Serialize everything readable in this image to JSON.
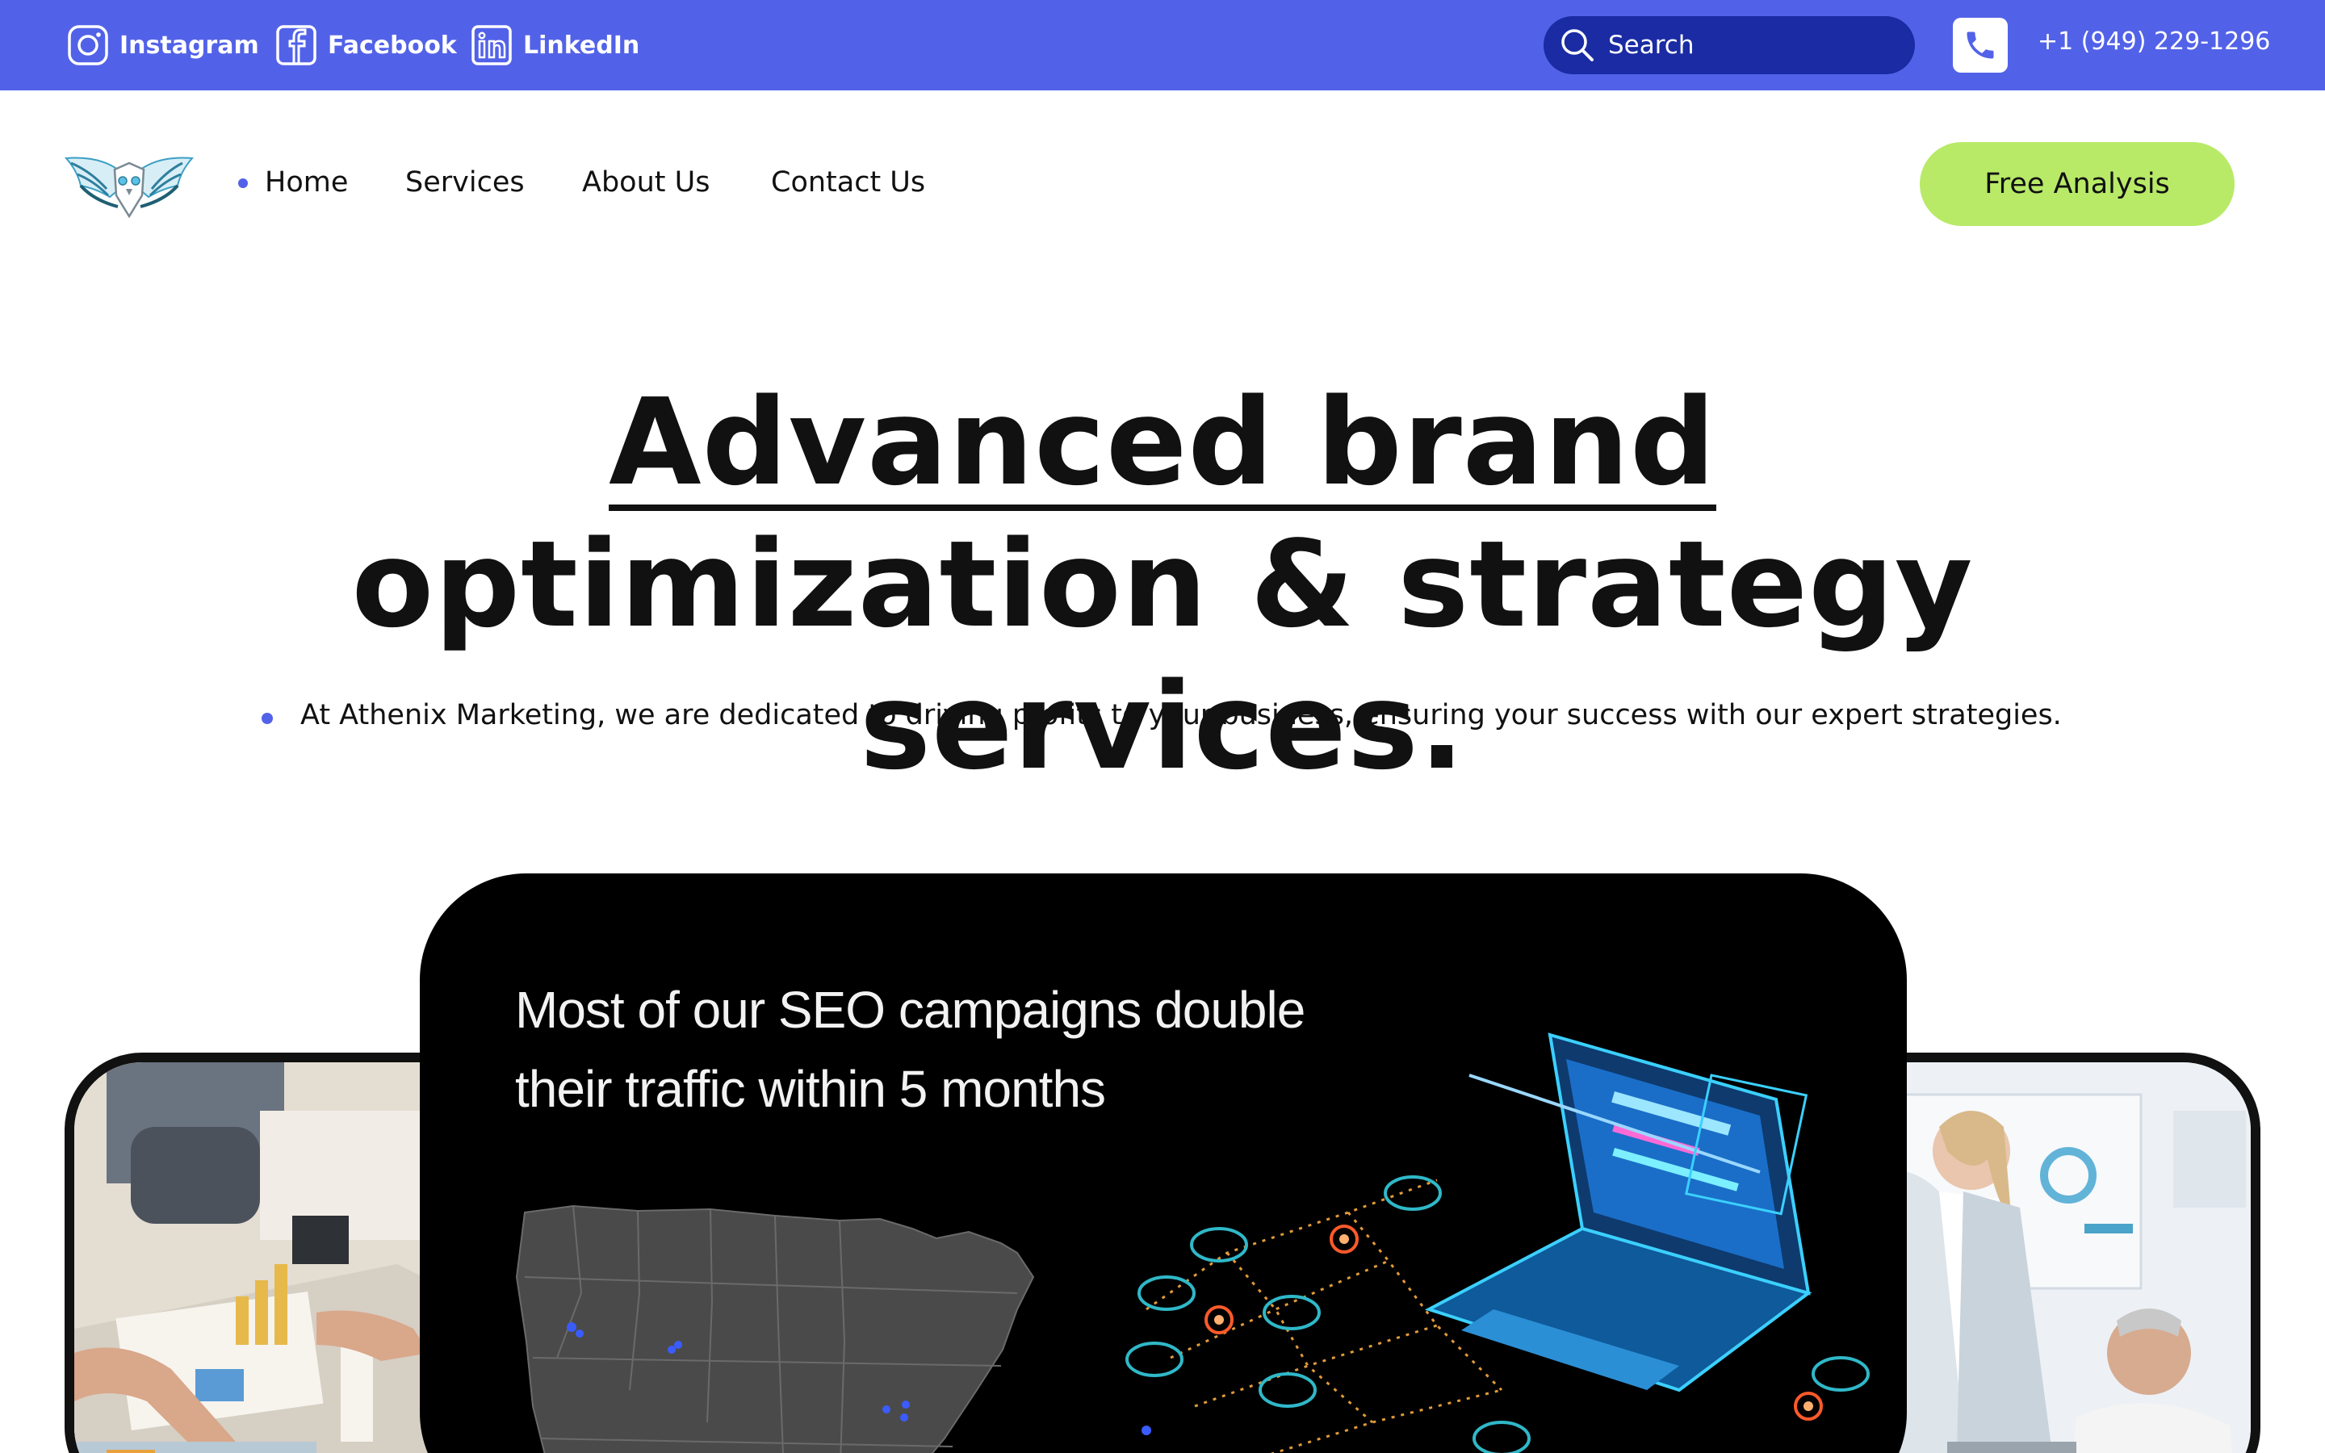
{
  "topbar": {
    "social": [
      {
        "label": "Instagram",
        "icon": "instagram-icon"
      },
      {
        "label": "Facebook",
        "icon": "facebook-icon"
      },
      {
        "label": "LinkedIn",
        "icon": "linkedin-icon"
      }
    ],
    "search": {
      "placeholder": "Search",
      "icon": "search-icon"
    },
    "phone": {
      "number": "+1 (949) 229-1296",
      "icon": "phone-icon"
    }
  },
  "nav": {
    "logo_icon": "owl-wings-logo",
    "items": [
      {
        "label": "Home",
        "active": true
      },
      {
        "label": "Services"
      },
      {
        "label": "About Us"
      },
      {
        "label": "Contact Us"
      }
    ],
    "cta": "Free Analysis"
  },
  "hero": {
    "headline_part1": "Advanced brand ",
    "headline_part2": "optimization & strategy services.",
    "subtext": "At Athenix Marketing, we are dedicated to driving profits to your business, ensuring your success with our expert strategies."
  },
  "showcase": {
    "promo_line1": "Most of our SEO campaigns double",
    "promo_line2": "their traffic within 5 months",
    "left_image": "team-analyzing-charts-photo",
    "right_image": "woman-high-five-office-photo",
    "center_graphic": "usa-map-laptop-network-graphic"
  },
  "colors": {
    "topbar": "#5262e8",
    "search_bg": "#1a2ba3",
    "cta": "#b8ea68",
    "accent_dot": "#5262e8",
    "text": "#111111"
  }
}
